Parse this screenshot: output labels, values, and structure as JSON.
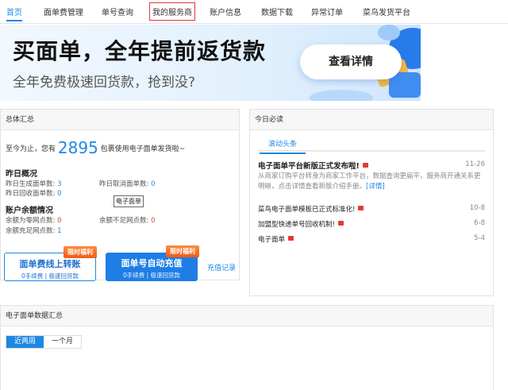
{
  "nav": {
    "items": [
      "首页",
      "面单费管理",
      "单号查询",
      "我的服务商",
      "账户信息",
      "数据下载",
      "异常订单",
      "菜鸟发货平台"
    ]
  },
  "banner": {
    "title": "买面单，全年提前返货款",
    "subtitle": "全年免费极速回货款，抢到没?",
    "button": "查看详情"
  },
  "summary": {
    "header": "总体汇总",
    "prefix": "至今为止，您有",
    "count": "2895",
    "suffix": "包裹使用电子面单发货啦~",
    "yesterday_title": "昨日概况",
    "yesterday": [
      {
        "label": "昨日生成面单数:",
        "value": "3"
      },
      {
        "label": "昨日取消面单数:",
        "value": "0"
      },
      {
        "label": "昨日回收面单数:",
        "value": "0"
      }
    ],
    "tooltip": "电子面单",
    "balance_title": "账户余额情况",
    "balance": [
      {
        "label": "余额为零网点数:",
        "value": "0"
      },
      {
        "label": "余额不足网点数:",
        "value": "0"
      },
      {
        "label": "余额充足网点数:",
        "value": "1"
      }
    ],
    "promo_one": {
      "title": "面单费线上转账",
      "sub": "0手续费 | 极速回货款",
      "tag": "限时福利"
    },
    "promo_two": {
      "title": "面单号自动充值",
      "sub": "0手续费 | 极速回货款",
      "tag": "限时福利"
    },
    "recharge_link": "充值记录"
  },
  "news": {
    "header": "今日必读",
    "tab": "滚动头条",
    "headline": "电子面单平台新版正式发布啦!",
    "headline_date": "11-26",
    "desc": "从商家订购平台转身为商家工作平台，数据查询更扁平，服务商开通关系更明晰，点击详情查看新版介绍手册。",
    "desc_link": "[详情]",
    "items": [
      {
        "title": "菜鸟电子面单模板已正式标准化!",
        "date": "10-8"
      },
      {
        "title": "加盟型快递单号回收机制!",
        "date": "6-8"
      },
      {
        "title": "电子面单",
        "date": "5-4"
      }
    ]
  },
  "data_summary": {
    "header": "电子面单数据汇总",
    "tabs": [
      "近两周",
      "一个月"
    ]
  },
  "colors": {
    "accent": "#1e88e5",
    "alert": "#e53935",
    "promo_tag": "#f25a16"
  }
}
